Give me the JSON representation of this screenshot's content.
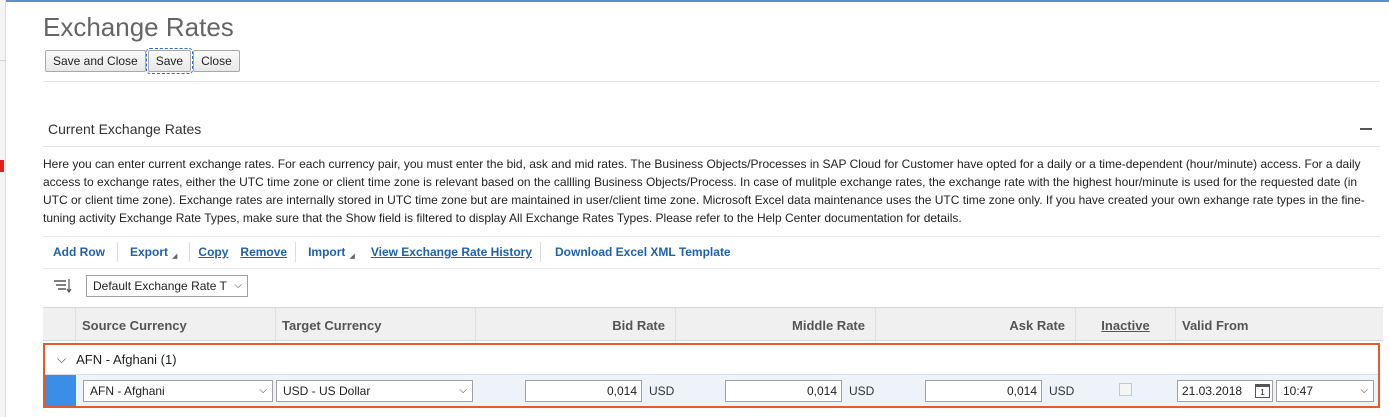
{
  "page": {
    "title": "Exchange Rates"
  },
  "toolbar": {
    "save_close": "Save and Close",
    "save": "Save",
    "close": "Close"
  },
  "section": {
    "title": "Current Exchange Rates",
    "description": "Here you can enter current exchange rates. For each currency pair, you must enter the bid, ask and mid rates. The Business Objects/Processes in SAP Cloud for Customer have opted for a daily or a time-dependent (hour/minute) access. For a daily access to exchange rates, either the UTC time zone or client time zone is relevant based on the callling Business Objects/Process. In case of mulitple exchange rates, the exchange rate with the highest hour/minute is used for the requested date (in UTC or client time zone). Exchange rates are internally stored in UTC time zone but are maintained in user/client time zone. Microsoft Excel data maintenance uses the UTC time zone only. If you have created your own exhange rate types in the fine-tuning activity Exchange Rate Types, make sure that the Show field is filtered to display All Exchange Rates Types. Please refer to the Help Center documentation for details."
  },
  "actions": {
    "add_row": "Add Row",
    "export": "Export",
    "copy": "Copy",
    "remove": "Remove",
    "import": "Import",
    "history": "View Exchange Rate History",
    "download": "Download Excel XML Template"
  },
  "filter": {
    "selected": "Default Exchange Rate T"
  },
  "table": {
    "columns": {
      "source": "Source Currency",
      "target": "Target Currency",
      "bid": "Bid Rate",
      "middle": "Middle Rate",
      "ask": "Ask Rate",
      "inactive": "Inactive",
      "valid_from": "Valid From"
    },
    "group": {
      "label": "AFN - Afghani (1)"
    },
    "row": {
      "source": "AFN - Afghani",
      "target": "USD - US Dollar",
      "bid": "0,014",
      "bid_currency": "USD",
      "middle": "0,014",
      "middle_currency": "USD",
      "ask": "0,014",
      "ask_currency": "USD",
      "inactive": false,
      "date": "21.03.2018",
      "time": "10:47"
    }
  },
  "icons": {
    "sort": "sort-icon",
    "collapse": "collapse-icon",
    "calendar": "calendar-icon",
    "chevron": "chevron-down-icon"
  }
}
